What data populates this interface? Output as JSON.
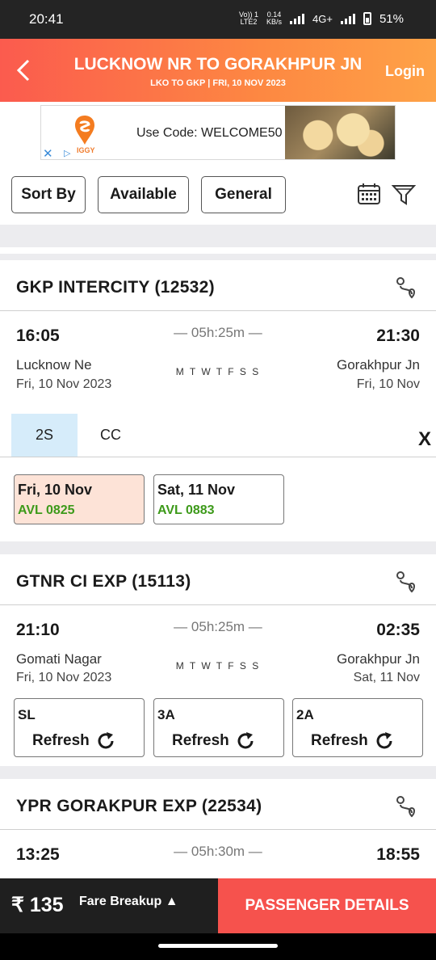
{
  "status": {
    "time": "20:41",
    "net_top": "0.14",
    "net_bottom": "KB/s",
    "volte_top": "Vo)) 1",
    "volte_bottom": "LTE2",
    "net_type": "4G+",
    "battery": "51%"
  },
  "header": {
    "title": "LUCKNOW NR TO GORAKHPUR JN",
    "subtitle": "LKO TO GKP | FRI, 10 NOV  2023",
    "login": "Login"
  },
  "ad": {
    "code_text": "Use Code: WELCOME50",
    "brand": "IGGY"
  },
  "filters": {
    "sort": "Sort By",
    "available": "Available",
    "quota": "General"
  },
  "trains": [
    {
      "name": "GKP INTERCITY (12532)",
      "dep_time": "16:05",
      "arr_time": "21:30",
      "duration": "05h:25m",
      "days": "M T W T F S S",
      "from": "Lucknow Ne",
      "to": "Gorakhpur Jn",
      "dep_date": "Fri, 10 Nov  2023",
      "arr_date": "Fri, 10 Nov",
      "classes": [
        "2S",
        "CC"
      ],
      "availability": [
        {
          "date": "Fri, 10 Nov",
          "status": "AVL 0825"
        },
        {
          "date": "Sat, 11 Nov",
          "status": "AVL 0883"
        }
      ]
    },
    {
      "name": "GTNR CI EXP (15113)",
      "dep_time": "21:10",
      "arr_time": "02:35",
      "duration": "05h:25m",
      "days": "M T W T F S S",
      "from": "Gomati Nagar",
      "to": "Gorakhpur Jn",
      "dep_date": "Fri, 10 Nov  2023",
      "arr_date": "Sat, 11 Nov",
      "refresh": [
        {
          "cls": "SL",
          "label": "Refresh"
        },
        {
          "cls": "3A",
          "label": "Refresh"
        },
        {
          "cls": "2A",
          "label": "Refresh"
        }
      ]
    },
    {
      "name": "YPR GORAKPUR EXP (22534)",
      "dep_time": "13:25",
      "arr_time": "18:55",
      "duration": "05h:30m"
    }
  ],
  "bottom": {
    "fare": "₹ 135",
    "fare_breakup": "Fare Breakup ▲",
    "cta": "PASSENGER DETAILS"
  },
  "colors": {
    "accent": "#f6524d",
    "available": "#3d9a1a",
    "selected_tab": "#d6ecfa",
    "selected_date": "#fde3d7"
  }
}
